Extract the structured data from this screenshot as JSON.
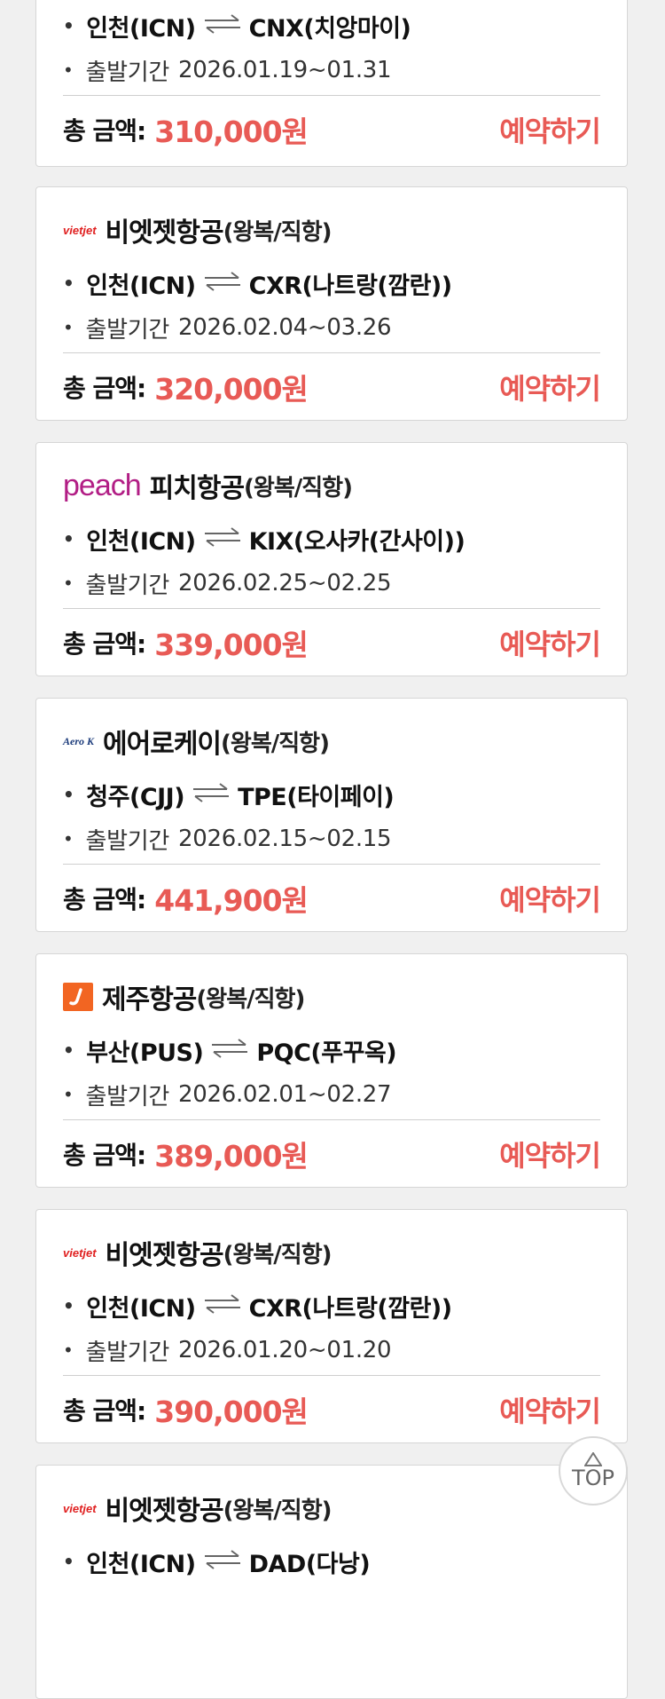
{
  "cards": [
    {
      "logo": "",
      "airline": "",
      "trip_type": "",
      "route_from": "인천(ICN)",
      "route_to": "CNX(치앙마이)",
      "period_label": "출발기간",
      "period": "2026.01.19~01.31",
      "total_label": "총 금액:",
      "price": "310,000원",
      "book_label": "예약하기"
    },
    {
      "logo": "vietjet",
      "logo_text": "vietjet",
      "airline": "비엣젯항공",
      "trip_type": "(왕복/직항)",
      "route_from": "인천(ICN)",
      "route_to": "CXR(나트랑(깜란))",
      "period_label": "출발기간",
      "period": "2026.02.04~03.26",
      "total_label": "총 금액:",
      "price": "320,000원",
      "book_label": "예약하기"
    },
    {
      "logo": "peach",
      "logo_text": "peach",
      "airline": "피치항공",
      "trip_type": "(왕복/직항)",
      "route_from": "인천(ICN)",
      "route_to": "KIX(오사카(간사이))",
      "period_label": "출발기간",
      "period": "2026.02.25~02.25",
      "total_label": "총 금액:",
      "price": "339,000원",
      "book_label": "예약하기"
    },
    {
      "logo": "aerok",
      "logo_text": "Aero K",
      "airline": "에어로케이",
      "trip_type": "(왕복/직항)",
      "route_from": "청주(CJJ)",
      "route_to": "TPE(타이페이)",
      "period_label": "출발기간",
      "period": "2026.02.15~02.15",
      "total_label": "총 금액:",
      "price": "441,900원",
      "book_label": "예약하기"
    },
    {
      "logo": "jeju",
      "airline": "제주항공",
      "trip_type": "(왕복/직항)",
      "route_from": "부산(PUS)",
      "route_to": "PQC(푸꾸옥)",
      "period_label": "출발기간",
      "period": "2026.02.01~02.27",
      "total_label": "총 금액:",
      "price": "389,000원",
      "book_label": "예약하기"
    },
    {
      "logo": "vietjet",
      "logo_text": "vietjet",
      "airline": "비엣젯항공",
      "trip_type": "(왕복/직항)",
      "route_from": "인천(ICN)",
      "route_to": "CXR(나트랑(깜란))",
      "period_label": "출발기간",
      "period": "2026.01.20~01.20",
      "total_label": "총 금액:",
      "price": "390,000원",
      "book_label": "예약하기"
    },
    {
      "logo": "vietjet",
      "logo_text": "vietjet",
      "airline": "비엣젯항공",
      "trip_type": "(왕복/직항)",
      "route_from": "인천(ICN)",
      "route_to": "DAD(다낭)",
      "period_label": "",
      "period": "",
      "total_label": "",
      "price": "",
      "book_label": ""
    }
  ],
  "top_button": {
    "label": "TOP",
    "icon": "triangle-up-icon"
  },
  "colors": {
    "price": "#e85a55",
    "book": "#e85a55",
    "jeju": "#f26522",
    "peach": "#b21e85",
    "vietjet": "#e02020"
  }
}
